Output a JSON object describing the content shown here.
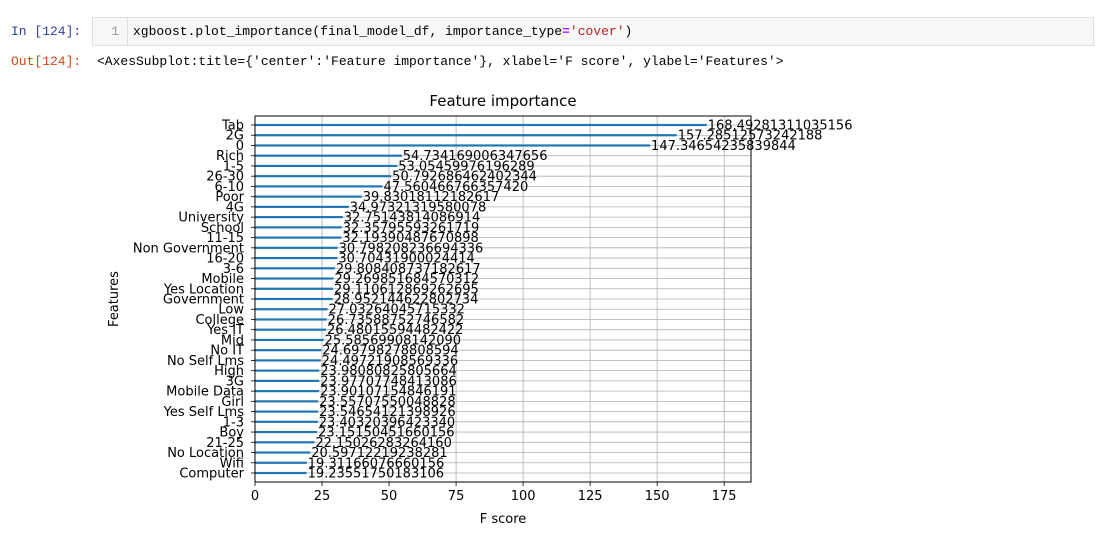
{
  "cell": {
    "in_prompt": "In [124]:",
    "out_prompt": "Out[124]:",
    "line_number": "1",
    "code_prefix": "xgboost.plot_importance(final_model_df, importance_type",
    "code_eq": "=",
    "code_string": "'cover'",
    "code_suffix": ")",
    "output_text": "<AxesSubplot:title={'center':'Feature importance'}, xlabel='F score', ylabel='Features'>"
  },
  "chart_data": {
    "type": "bar",
    "orientation": "horizontal",
    "title": "Feature importance",
    "xlabel": "F score",
    "ylabel": "Features",
    "xlim": [
      0,
      185
    ],
    "xticks": [
      0,
      25,
      50,
      75,
      100,
      125,
      150,
      175
    ],
    "grid": true,
    "bar_color": "#1f77b4",
    "categories": [
      "Tab",
      "2G",
      "0",
      "Rich",
      "1-5",
      "26-30",
      "6-10",
      "Poor",
      "4G",
      "University",
      "School",
      "11-15",
      "Non Government",
      "16-20",
      "3-6",
      "Mobile",
      "Yes Location",
      "Government",
      "Low",
      "College",
      "Yes IT",
      "Mid",
      "No IT",
      "No Self Lms",
      "High",
      "3G",
      "Mobile Data",
      "Girl",
      "Yes Self Lms",
      "1-3",
      "Boy",
      "21-25",
      "No Location",
      "Wifi",
      "Computer"
    ],
    "values": [
      168.49281311035156,
      157.28512573242188,
      147.34654235839844,
      54.734169006347656,
      53.05459976196289,
      50.792686462402344,
      47.56046676635742,
      39.83018112182617,
      34.97321319580078,
      32.75143814086914,
      32.35795593261719,
      32.19390487670898,
      30.798208236694336,
      30.70431900024414,
      29.808408737182617,
      29.269851684570312,
      29.110612869262695,
      28.952144622802734,
      27.03264045715332,
      26.73588752746582,
      26.48015594482422,
      25.5856990814209,
      24.69798278808594,
      24.49721908569336,
      23.98080825805664,
      23.97707748413086,
      23.90107154846191,
      23.55707550048828,
      23.54654121398926,
      23.4032039642334,
      23.15150451660156,
      22.1502628326416,
      20.59712219238281,
      19.31166076660156,
      19.23551750183106
    ],
    "value_labels": [
      "168.49281311035156",
      "157.28512573242188",
      "147.34654235839844",
      "54.734169006347656",
      "53.05459976196289",
      "50.792686462402344",
      "47.560466766357420",
      "39.83018112182617",
      "34.97321319580078",
      "32.75143814086914",
      "32.35795593261719",
      "32.19390487670898",
      "30.798208236694336",
      "30.70431900024414",
      "29.808408737182617",
      "29.269851684570312",
      "29.110612869262695",
      "28.952144622802734",
      "27.03264045715332",
      "26.73588752746582",
      "26.48015594482422",
      "25.58569908142090",
      "24.69798278808594",
      "24.49721908569336",
      "23.98080825805664",
      "23.97707748413086",
      "23.90107154846191",
      "23.55707550048828",
      "23.54654121398926",
      "23.40320396423340",
      "23.15150451660156",
      "22.15026283264160",
      "20.59712219238281",
      "19.31166076660156",
      "19.23551750183106"
    ]
  }
}
